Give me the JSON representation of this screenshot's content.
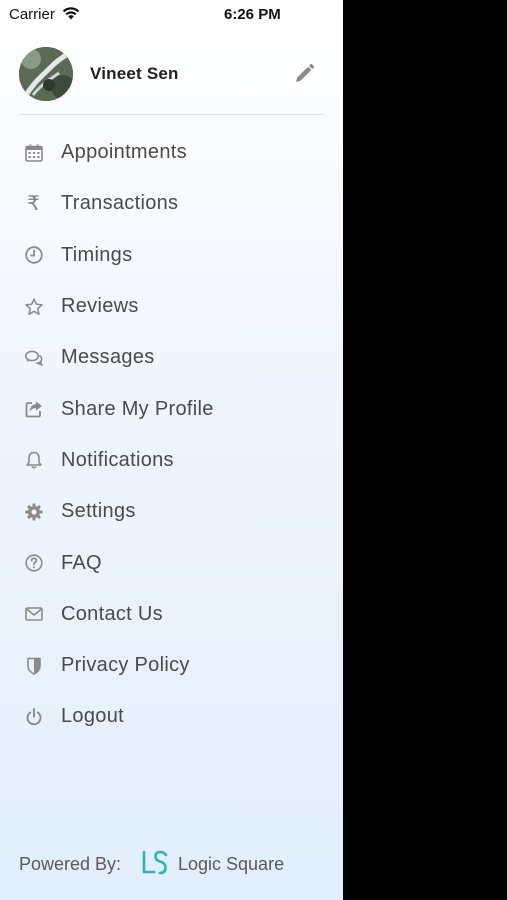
{
  "status_bar": {
    "carrier": "Carrier",
    "time": "6:26 PM",
    "wifi_icon": "wifi-icon"
  },
  "profile": {
    "name": "Vineet Sen",
    "edit_icon": "pencil-icon"
  },
  "menu": [
    {
      "label": "Appointments",
      "icon": "calendar-icon"
    },
    {
      "label": "Transactions",
      "icon": "rupee-icon"
    },
    {
      "label": "Timings",
      "icon": "clock-icon"
    },
    {
      "label": "Reviews",
      "icon": "star-icon"
    },
    {
      "label": "Messages",
      "icon": "chat-bubbles-icon"
    },
    {
      "label": "Share My Profile",
      "icon": "share-icon"
    },
    {
      "label": "Notifications",
      "icon": "bell-icon"
    },
    {
      "label": "Settings",
      "icon": "gear-icon"
    },
    {
      "label": "FAQ",
      "icon": "question-circle-icon"
    },
    {
      "label": "Contact Us",
      "icon": "envelope-icon"
    },
    {
      "label": "Privacy Policy",
      "icon": "shield-icon"
    },
    {
      "label": "Logout",
      "icon": "power-icon"
    }
  ],
  "footer": {
    "powered_by": "Powered By:",
    "brand": "Logic Square",
    "brand_color": "#2bb3c0"
  },
  "colors": {
    "icon": "#8a8a8a",
    "label": "#4a4a4a",
    "overlay": "#000000"
  }
}
